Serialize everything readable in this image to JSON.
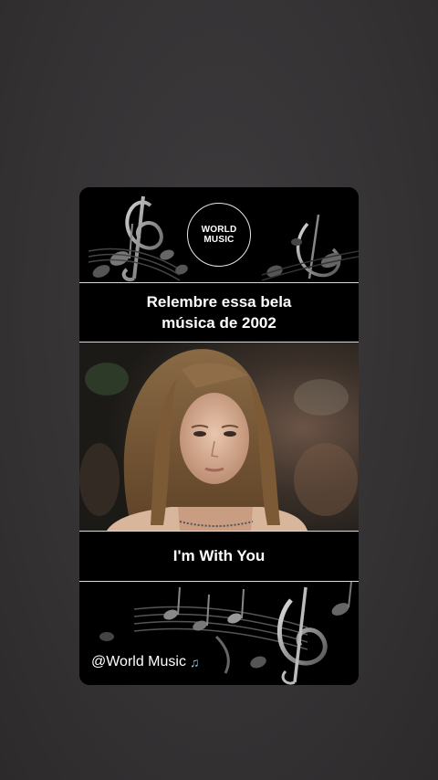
{
  "logo": {
    "text": "WORLD MUSIC"
  },
  "headline": {
    "line1": "Relembre essa bela",
    "line2": "música de 2002"
  },
  "song": {
    "title": "I'm With You"
  },
  "footer": {
    "handle": "@World Music",
    "icon": "music-note-icon"
  },
  "colors": {
    "card_bg": "#000000",
    "page_bg": "#353334",
    "divider": "#d9d9d9",
    "text": "#ffffff"
  }
}
